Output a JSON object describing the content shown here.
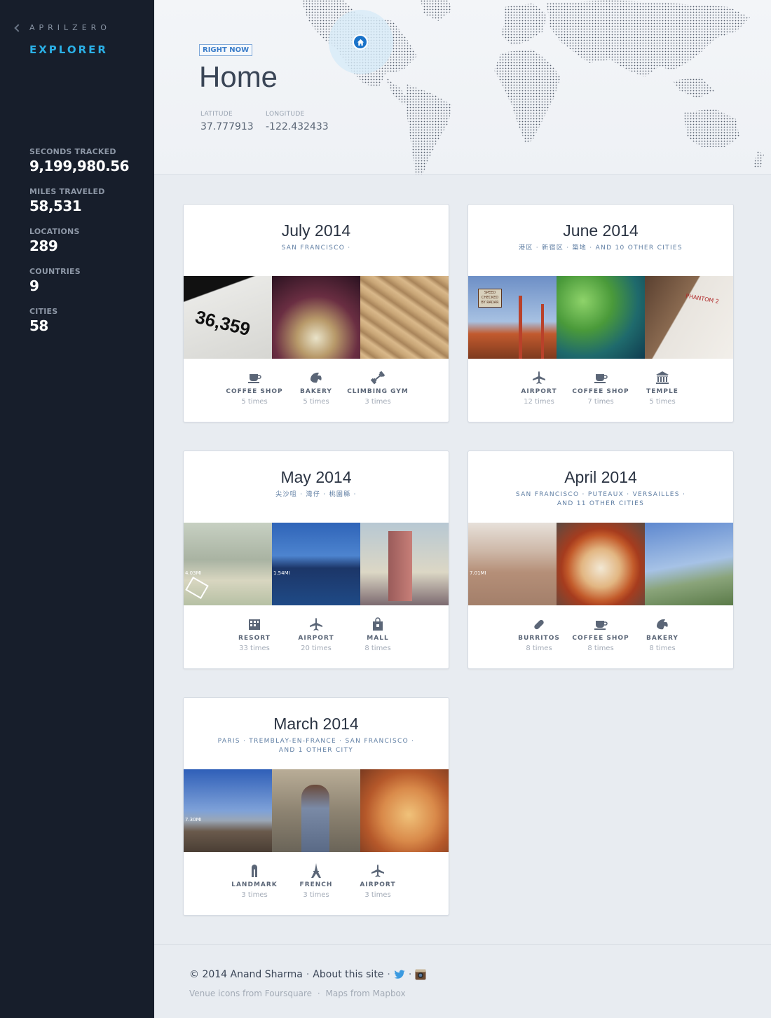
{
  "sidebar": {
    "brand": "APRILZERO",
    "section": "EXPLORER",
    "stats": [
      {
        "label": "SECONDS TRACKED",
        "value": "9,199,980.56"
      },
      {
        "label": "MILES TRAVELED",
        "value": "58,531"
      },
      {
        "label": "LOCATIONS",
        "value": "289"
      },
      {
        "label": "COUNTRIES",
        "value": "9"
      },
      {
        "label": "CITIES",
        "value": "58"
      }
    ]
  },
  "header": {
    "badge": "RIGHT NOW",
    "title": "Home",
    "latitude_label": "LATITUDE",
    "latitude": "37.777913",
    "longitude_label": "LONGITUDE",
    "longitude": "-122.432433"
  },
  "months": [
    {
      "title": "July 2014",
      "subtitle": "SAN FRANCISCO ·",
      "photos": [
        "36,359 receipt",
        "cocktail glass",
        "sand dunes"
      ],
      "venues": [
        {
          "icon": "coffee-cup-icon",
          "name": "COFFEE SHOP",
          "times": "5 times"
        },
        {
          "icon": "croissant-icon",
          "name": "BAKERY",
          "times": "5 times"
        },
        {
          "icon": "dumbbell-icon",
          "name": "CLIMBING GYM",
          "times": "3 times"
        }
      ]
    },
    {
      "title": "June 2014",
      "subtitle": "港区 · 新宿区 · 築地 · AND 10 OTHER CITIES",
      "photos": [
        "golden gate bridge",
        "koi pond",
        "phantom box"
      ],
      "venues": [
        {
          "icon": "airplane-icon",
          "name": "AIRPORT",
          "times": "12 times"
        },
        {
          "icon": "coffee-cup-icon",
          "name": "COFFEE SHOP",
          "times": "7 times"
        },
        {
          "icon": "temple-icon",
          "name": "TEMPLE",
          "times": "5 times"
        }
      ]
    },
    {
      "title": "May 2014",
      "subtitle": "尖沙咀 · 灣仔 · 桃園縣 ·",
      "photos": [
        "city buildings",
        "hong kong skyline",
        "tower"
      ],
      "venues": [
        {
          "icon": "resort-icon",
          "name": "RESORT",
          "times": "33 times"
        },
        {
          "icon": "airplane-icon",
          "name": "AIRPORT",
          "times": "20 times"
        },
        {
          "icon": "shopping-bag-icon",
          "name": "MALL",
          "times": "8 times"
        }
      ]
    },
    {
      "title": "April 2014",
      "subtitle": "SAN FRANCISCO · PUTEAUX · VERSAILLES · AND 11 OTHER CITIES",
      "photos": [
        "beach",
        "pizza",
        "coastline"
      ],
      "venues": [
        {
          "icon": "burrito-icon",
          "name": "BURRITOS",
          "times": "8 times"
        },
        {
          "icon": "coffee-cup-icon",
          "name": "COFFEE SHOP",
          "times": "8 times"
        },
        {
          "icon": "croissant-icon",
          "name": "BAKERY",
          "times": "8 times"
        }
      ]
    },
    {
      "title": "March 2014",
      "subtitle": "PARIS · TREMBLAY-EN-FRANCE · SAN FRANCISCO · AND 1 OTHER CITY",
      "photos": [
        "ocean beach",
        "man portrait",
        "pastry"
      ],
      "venues": [
        {
          "icon": "landmark-icon",
          "name": "LANDMARK",
          "times": "3 times"
        },
        {
          "icon": "eiffel-tower-icon",
          "name": "FRENCH",
          "times": "3 times"
        },
        {
          "icon": "airplane-icon",
          "name": "AIRPORT",
          "times": "3 times"
        }
      ]
    }
  ],
  "photo_labels": {
    "july_receipt": "36,359",
    "may_run_1": "4.03MI",
    "may_run_2": "1.54MI",
    "april_run": "7.01MI",
    "march_run": "7.30MI",
    "june_sign": "SPEED CHECKED BY RADAR",
    "june_box": "PHANTOM 2"
  },
  "footer": {
    "copyright": "© 2014 Anand Sharma",
    "about": "About this site",
    "credits_venue": "Venue icons from Foursquare",
    "credits_maps": "Maps from Mapbox"
  },
  "colors": {
    "sidebar_bg": "#171e2b",
    "accent": "#2bb0e6",
    "page_bg": "#e8ecf1",
    "home_pin": "#1a73c9"
  }
}
